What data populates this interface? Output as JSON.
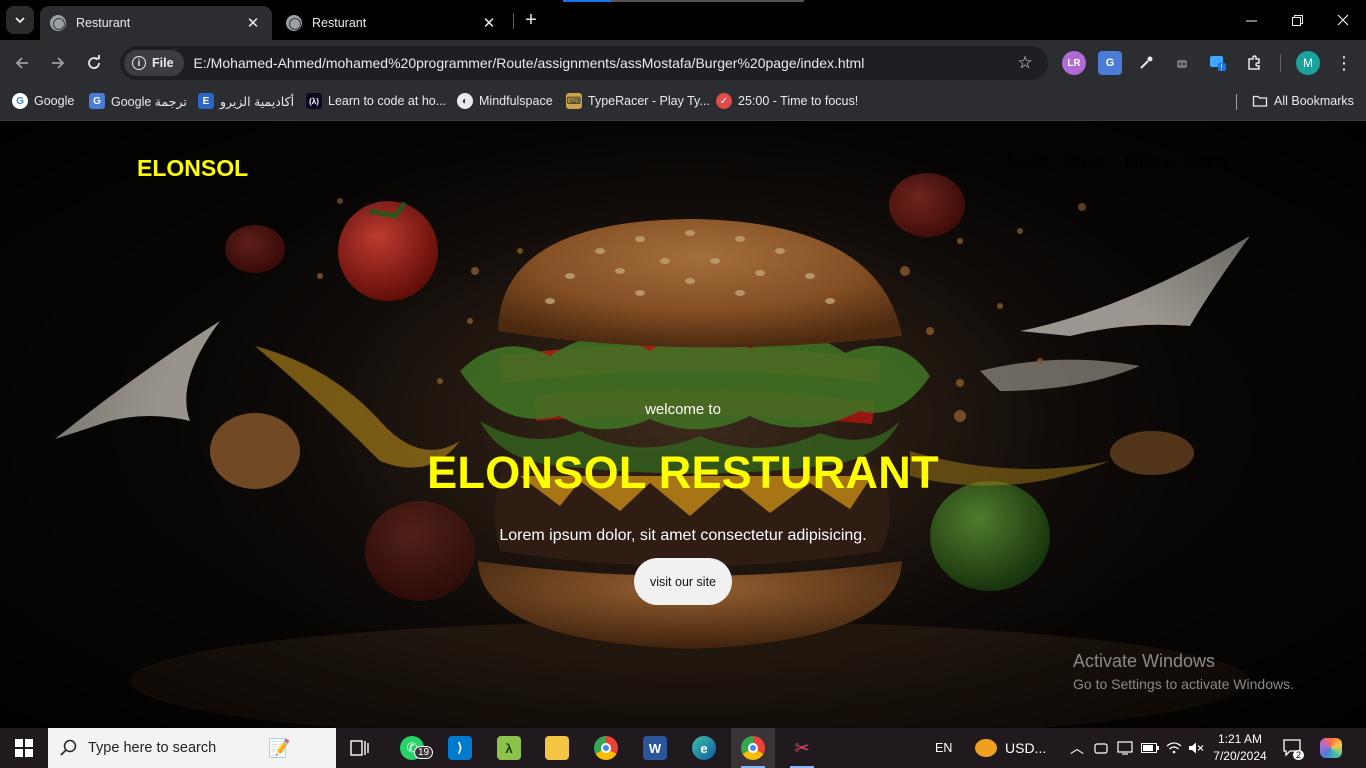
{
  "browser": {
    "tabs": [
      {
        "title": "Resturant",
        "active": true
      },
      {
        "title": "Resturant",
        "active": false
      }
    ],
    "new_tab_label": "+",
    "site_chip": "File",
    "url": "E:/Mohamed-Ahmed/mohamed%20programmer/Route/assignments/assMostafa/Burger%20page/index.html",
    "profile_initial": "M",
    "bookmarks": [
      {
        "label": "Google",
        "icon": "google-icon"
      },
      {
        "label": "Google ترجمة",
        "icon": "translate-icon"
      },
      {
        "label": "أكاديمية الزيرو",
        "icon": "academy-icon"
      },
      {
        "label": "Learn to code at ho...",
        "icon": "freecodecamp-icon"
      },
      {
        "label": "Mindfulspace",
        "icon": "mindfulspace-icon"
      },
      {
        "label": "TypeRacer - Play Ty...",
        "icon": "typeracer-icon"
      },
      {
        "label": "25:00 - Time to focus!",
        "icon": "pomofocus-icon"
      }
    ],
    "all_bookmarks_label": "All Bookmarks"
  },
  "site": {
    "brand": "ELONSOL",
    "nav": [
      "Home",
      "About",
      "Menue",
      "Offers"
    ],
    "welcome": "welcome to",
    "title": "ELONSOL RESTURANT",
    "subtitle": "Lorem ipsum dolor, sit amet consectetur adipisicing.",
    "cta_label": "visit our site"
  },
  "watermark": {
    "line1": "Activate Windows",
    "line2": "Go to Settings to activate Windows."
  },
  "taskbar": {
    "search_placeholder": "Type here to search",
    "whatsapp_badge": "19",
    "language": "EN",
    "currency_widget": "USD...",
    "time": "1:21 AM",
    "date": "7/20/2024",
    "notification_count": "2"
  },
  "colors": {
    "brand_yellow": "#ffff00",
    "browser_bg": "#2b2d30",
    "taskbar_bg": "#201a1f"
  }
}
